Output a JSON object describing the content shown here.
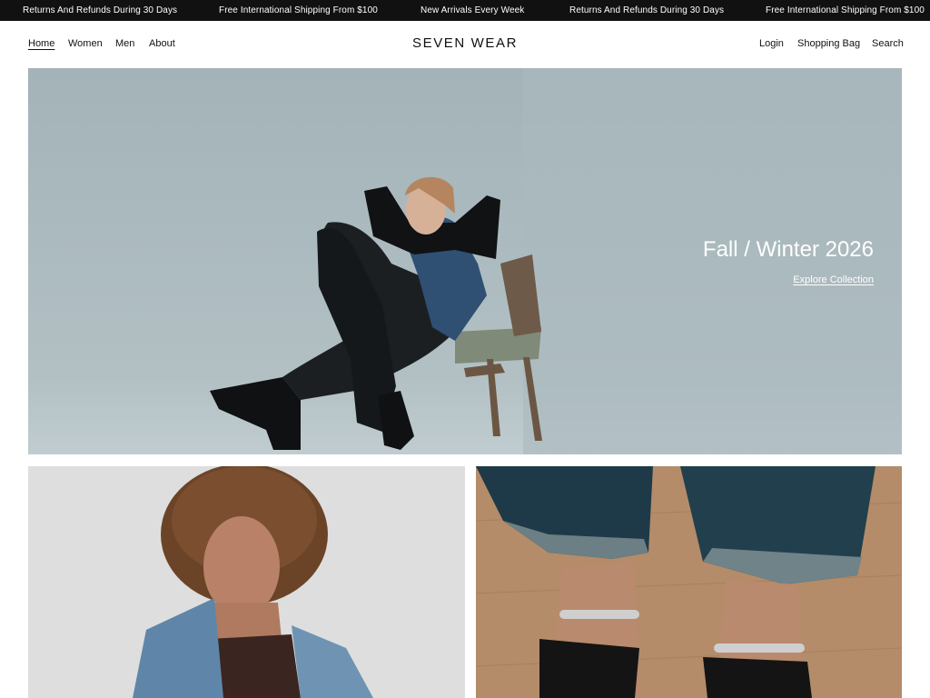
{
  "announcement": {
    "items": [
      "Returns And Refunds During 30 Days",
      "Free International Shipping From $100",
      "New Arrivals Every Week",
      "Returns And Refunds During 30 Days",
      "Free International Shipping From $100"
    ]
  },
  "header": {
    "left_nav": [
      "Home",
      "Women",
      "Men",
      "About"
    ],
    "logo": "SEVEN WEAR",
    "right_nav": [
      "Login",
      "Shopping Bag",
      "Search"
    ]
  },
  "hero": {
    "title": "Fall / Winter 2026",
    "link": "Explore Collection"
  },
  "colors": {
    "announcement_bg": "#111111",
    "hero_bg": "#a9b8bd",
    "text": "#111111"
  }
}
